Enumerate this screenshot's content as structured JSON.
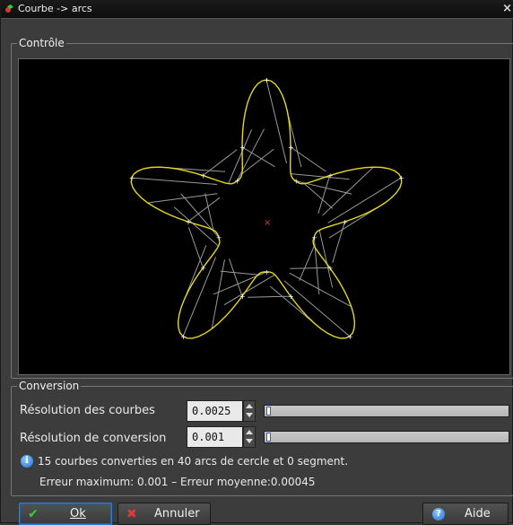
{
  "window": {
    "title": "Courbe -> arcs",
    "close_glyph": "×"
  },
  "control_group": {
    "label": "Contrôle"
  },
  "conversion_group": {
    "label": "Conversion"
  },
  "curve_resolution": {
    "label": "Résolution des courbes",
    "value": "0.0025",
    "slider_fraction": 0.02
  },
  "conversion_resolution": {
    "label": "Résolution de conversion",
    "value": "0.001",
    "slider_fraction": 0.02
  },
  "summary": {
    "line1": "15 courbes converties en 40 arcs de cercle et 0 segment.",
    "line2": "Erreur maximum: 0.001 – Erreur moyenne:0.00045"
  },
  "buttons": {
    "ok": "Ok",
    "cancel": "Annuler",
    "help": "Aide"
  },
  "icons": {
    "title": "app-icon",
    "ok": "checkmark-icon",
    "cancel": "x-icon",
    "help": "help-icon",
    "info": "info-icon"
  },
  "colors": {
    "curve": "#e6d81a",
    "control_lines": "#9a9a9a",
    "center_marker": "#d23c3c",
    "accent": "#2f7de0"
  }
}
